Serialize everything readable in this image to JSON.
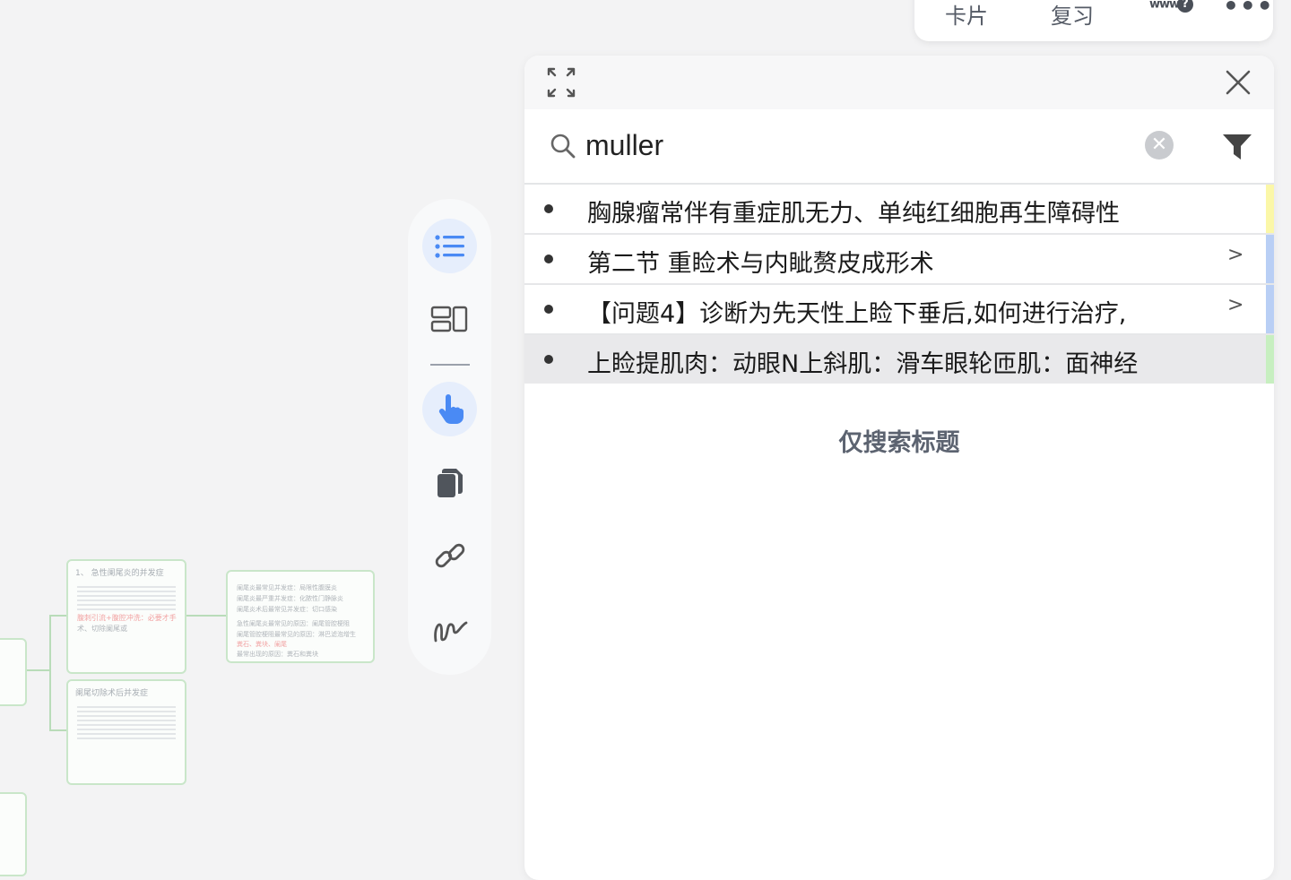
{
  "toolbar": {
    "cards_label": "卡片",
    "review_label": "复习",
    "www_label": "www",
    "more_label": "•••"
  },
  "panel": {
    "search": {
      "value": "muller",
      "clear_label": "✕"
    },
    "results": [
      {
        "text": "胸腺瘤常伴有重症肌无力、单纯红细胞再生障碍性",
        "color": "#fbf7a8",
        "has_children": false
      },
      {
        "text": "第二节 重睑术与内眦赘皮成形术",
        "color": "#b9cff5",
        "has_children": true
      },
      {
        "text": "【问题4】诊断为先天性上睑下垂后,如何进行治疗,",
        "color": "#b9cff5",
        "has_children": true
      },
      {
        "text": "上睑提肌肉：动眼N上斜肌：滑车眼轮匝肌：面神经",
        "color": "#c7efc0",
        "has_children": false,
        "highlighted": true
      }
    ],
    "chevron": ">",
    "only_title_label": "仅搜索标题"
  },
  "mindmap": {
    "node1_title": "1、 急性阑尾炎的并发症",
    "node1_red": "腹刺引流+腹腔冲洗：必要才手",
    "node1_gray": "术、切除阑尾或",
    "node2_title": "阑尾切除术后并发症",
    "node3_line1": "阑尾炎最常见并发症：局限性腹膜炎",
    "node3_line2": "阑尾炎最严重并发症：化脓性门静脉炎",
    "node3_line3": "阑尾炎术后最常见并发症：切口感染",
    "node3_line4": "急性阑尾炎最常见的原因：阑尾管腔梗阻",
    "node3_line5": "阑尾管腔梗阻最常见的原因：淋巴滤泡增生",
    "node3_line6": "最常出现的原因：粪石和粪块",
    "node3_red": "粪石、粪块、阑尾"
  },
  "colors": {
    "accent": "#4a8af4",
    "highlight_row": "#e9e9eb"
  },
  "icons": [
    "expand-icon",
    "close-icon",
    "search-icon",
    "filter-icon",
    "outline-list-icon",
    "layout-icon",
    "pointer-hand-icon",
    "copy-icon",
    "link-icon",
    "handwriting-icon"
  ]
}
